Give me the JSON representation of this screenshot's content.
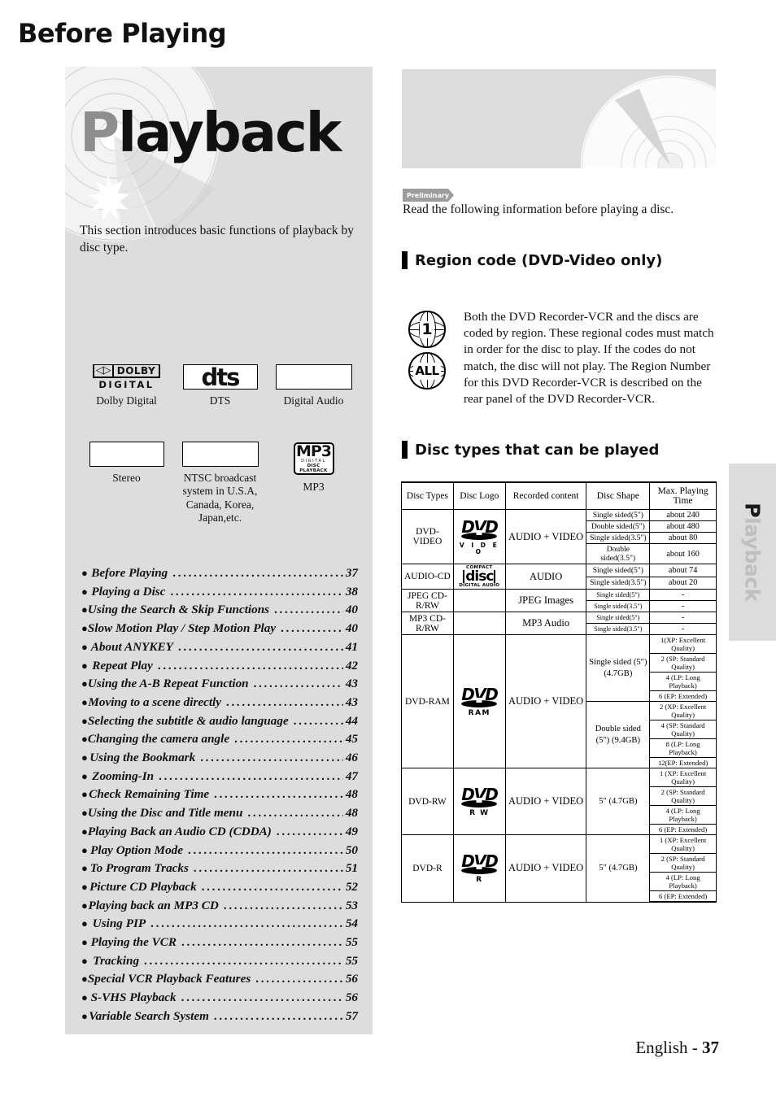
{
  "left": {
    "hero_title_first": "P",
    "hero_title_rest": "layback",
    "intro": "This section introduces basic functions of playback by disc type.",
    "logos": [
      {
        "name": "Dolby Digital",
        "glyph": "dolby-digital-logo"
      },
      {
        "name": "DTS",
        "glyph": "dts-logo"
      },
      {
        "name": "Digital Audio",
        "glyph": "blank-box"
      },
      {
        "name": "Stereo",
        "glyph": "blank-box"
      },
      {
        "name": "NTSC broadcast system in U.S.A, Canada, Korea, Japan,etc.",
        "glyph": "blank-box"
      },
      {
        "name": "MP3",
        "glyph": "mp3-logo"
      }
    ],
    "dolby_dd": "DD",
    "dolby_word": "DOLBY",
    "dolby_bottom": "DIGITAL",
    "dts_word": "dts",
    "mp3_main": "MP3",
    "mp3_sub1": "DIGITAL",
    "mp3_sub2": "DISC PLAYBACK",
    "toc": [
      {
        "label": "Before Playing",
        "page": "37"
      },
      {
        "label": "Playing a Disc",
        "page": "38"
      },
      {
        "label": "Using the Search & Skip Functions",
        "page": "40"
      },
      {
        "label": "Slow Motion Play / Step Motion Play",
        "page": "40"
      },
      {
        "label": "About ANYKEY",
        "page": "41"
      },
      {
        "label": "Repeat Play",
        "page": "42"
      },
      {
        "label": "Using the A-B Repeat Function",
        "page": "43"
      },
      {
        "label": "Moving to a scene directly",
        "page": "43"
      },
      {
        "label": "Selecting the subtitle & audio language",
        "page": "44"
      },
      {
        "label": "Changing the camera angle",
        "page": "45"
      },
      {
        "label": "Using the Bookmark",
        "page": "46"
      },
      {
        "label": "Zooming-In",
        "page": "47"
      },
      {
        "label": "Check Remaining Time",
        "page": "48"
      },
      {
        "label": "Using the Disc and Title menu",
        "page": "48"
      },
      {
        "label": "Playing Back an Audio CD (CDDA)",
        "page": "49"
      },
      {
        "label": "Play Option Mode",
        "page": "50"
      },
      {
        "label": "To Program Tracks",
        "page": "51"
      },
      {
        "label": "Picture CD Playback",
        "page": "52"
      },
      {
        "label": "Playing back an MP3 CD",
        "page": "53"
      },
      {
        "label": "Using PIP",
        "page": "54"
      },
      {
        "label": "Playing the VCR",
        "page": "55"
      },
      {
        "label": "Tracking",
        "page": "55"
      },
      {
        "label": "Special VCR Playback Features",
        "page": "56"
      },
      {
        "label": "S-VHS Playback",
        "page": "56"
      },
      {
        "label": "Variable Search System",
        "page": "57"
      }
    ]
  },
  "right": {
    "chapter_title": "Before Playing",
    "preliminary_badge": "Preliminary",
    "preliminary_text": "Read the following information before playing a disc.",
    "section_region": "Region code (DVD-Video only)",
    "region_icon_1": "1",
    "region_icon_all": "ALL",
    "region_text": "Both the DVD Recorder-VCR and the discs are coded by region. These regional codes must match in order for the disc to play. If the codes do not match, the disc will not play. The Region Number for this DVD Recorder-VCR is described on the rear panel of the DVD Recorder-VCR.",
    "section_disctypes": "Disc types that can be played"
  },
  "table": {
    "headers": [
      "Disc Types",
      "Disc Logo",
      "Recorded content",
      "Disc Shape",
      "Max. Playing Time"
    ],
    "rows": [
      {
        "type": "DVD-VIDEO",
        "logo": "dvd-video-logo",
        "logo_main": "DVD",
        "logo_sub": "V I D E O",
        "content": "AUDIO + VIDEO",
        "shapes": [
          {
            "shape": "Single sided(5\")",
            "time": "about 240"
          },
          {
            "shape": "Double sided(5\")",
            "time": "about 480"
          },
          {
            "shape": "Single sided(3.5\")",
            "time": "about 80"
          },
          {
            "shape": "Double sided(3.5\")",
            "time": "about 160"
          }
        ]
      },
      {
        "type": "AUDIO-CD",
        "logo": "compact-disc-digital-audio-logo",
        "logo_top": "COMPACT",
        "logo_mid": "disc",
        "logo_bot": "DIGITAL AUDIO",
        "content": "AUDIO",
        "shapes": [
          {
            "shape": "Single sided(5\")",
            "time": "about 74"
          },
          {
            "shape": "Single sided(3.5\")",
            "time": "about 20"
          }
        ]
      },
      {
        "type": "JPEG CD-R/RW",
        "logo": "",
        "content": "JPEG Images",
        "shapes": [
          {
            "shape": "Single sided(5\")",
            "time": "-"
          },
          {
            "shape": "Single sided(3.5\")",
            "time": "-"
          }
        ]
      },
      {
        "type": "MP3 CD-R/RW",
        "logo": "",
        "content": "MP3 Audio",
        "shapes": [
          {
            "shape": "Single sided(5\")",
            "time": "-"
          },
          {
            "shape": "Single sided(3.5\")",
            "time": "-"
          }
        ]
      },
      {
        "type": "DVD-RAM",
        "logo": "dvd-ram-logo",
        "logo_main": "DVD",
        "logo_sub": "RAM",
        "content": "AUDIO + VIDEO",
        "groups": [
          {
            "shape": "Single sided (5\") (4.7GB)",
            "times": [
              "1(XP: Excellent Quality)",
              "2 (SP: Standard Quality)",
              "4 (LP: Long Playback)",
              "6 (EP: Extended)"
            ]
          },
          {
            "shape": "Double sided (5\") (9.4GB)",
            "times": [
              "2 (XP: Excellent Quality)",
              "4 (SP: Standard Quality)",
              "8 (LP: Long Playback)",
              "12(EP: Extended)"
            ]
          }
        ]
      },
      {
        "type": "DVD-RW",
        "logo": "dvd-rw-logo",
        "logo_main": "DVD",
        "logo_sub": "R W",
        "content": "AUDIO + VIDEO",
        "groups": [
          {
            "shape": "5\" (4.7GB)",
            "times": [
              "1 (XP: Excellent Quality)",
              "2 (SP: Standard Quality)",
              "4 (LP: Long Playback)",
              "6 (EP: Extended)"
            ]
          }
        ]
      },
      {
        "type": "DVD-R",
        "logo": "dvd-r-logo",
        "logo_main": "DVD",
        "logo_sub": "R",
        "content": "AUDIO + VIDEO",
        "groups": [
          {
            "shape": "5\" (4.7GB)",
            "times": [
              "1 (XP: Excellent Quality)",
              "2 (SP: Standard Quality)",
              "4 (LP: Long Playback)",
              "6 (EP: Extended)"
            ]
          }
        ]
      }
    ]
  },
  "side_tab": {
    "first": "P",
    "rest": "layback"
  },
  "footer": {
    "language": "English - ",
    "page": "37"
  }
}
